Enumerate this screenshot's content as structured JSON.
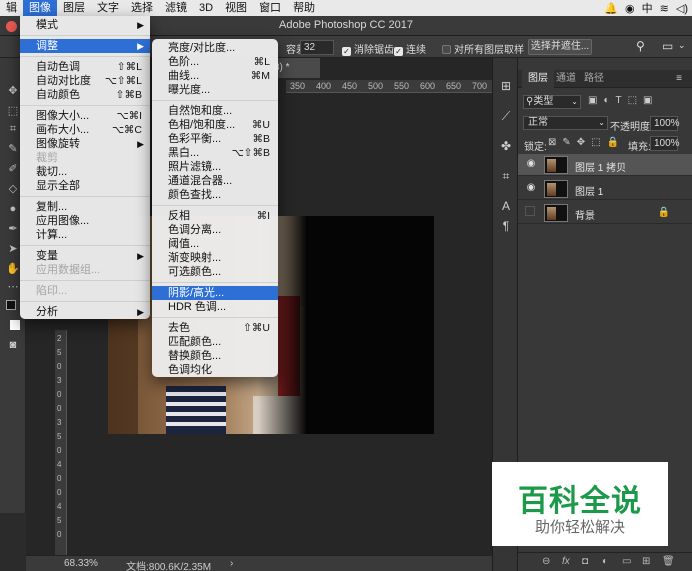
{
  "menubar": {
    "items": [
      "辑",
      "图像",
      "图层",
      "文字",
      "选择",
      "滤镜",
      "3D",
      "视图",
      "窗口",
      "帮助"
    ],
    "active_index": 1
  },
  "window": {
    "title": "Adobe Photoshop CC 2017"
  },
  "options_bar": {
    "tolerance_label": "容差:",
    "tolerance_value": "32",
    "antialias_label": "消除锯齿",
    "contiguous_label": "连续",
    "sample_all_label": "对所有图层取样",
    "select_mask_button": "选择并遮住..."
  },
  "document": {
    "tab_fragment": "8) *",
    "ruler_ticks": [
      "350",
      "400",
      "450",
      "500",
      "550",
      "600",
      "650",
      "700"
    ],
    "vruler_ticks": [
      "2",
      "5",
      "0",
      "3",
      "0",
      "0",
      "3",
      "5",
      "0",
      "4",
      "0",
      "0",
      "4",
      "5",
      "0"
    ]
  },
  "status": {
    "zoom": "68.33%",
    "doc": "文档:800.6K/2.35M",
    "arrow": "›"
  },
  "image_menu": [
    {
      "type": "item",
      "label": "模式",
      "submenu": true
    },
    {
      "type": "sep"
    },
    {
      "type": "item",
      "label": "调整",
      "submenu": true,
      "highlight": true
    },
    {
      "type": "sep"
    },
    {
      "type": "item",
      "label": "自动色调",
      "shortcut": "⇧⌘L"
    },
    {
      "type": "item",
      "label": "自动对比度",
      "shortcut": "⌥⇧⌘L"
    },
    {
      "type": "item",
      "label": "自动颜色",
      "shortcut": "⇧⌘B"
    },
    {
      "type": "sep"
    },
    {
      "type": "item",
      "label": "图像大小...",
      "shortcut": "⌥⌘I"
    },
    {
      "type": "item",
      "label": "画布大小...",
      "shortcut": "⌥⌘C"
    },
    {
      "type": "item",
      "label": "图像旋转",
      "submenu": true
    },
    {
      "type": "item",
      "label": "裁剪",
      "disabled": true
    },
    {
      "type": "item",
      "label": "裁切..."
    },
    {
      "type": "item",
      "label": "显示全部"
    },
    {
      "type": "sep"
    },
    {
      "type": "item",
      "label": "复制..."
    },
    {
      "type": "item",
      "label": "应用图像..."
    },
    {
      "type": "item",
      "label": "计算..."
    },
    {
      "type": "sep"
    },
    {
      "type": "item",
      "label": "变量",
      "submenu": true
    },
    {
      "type": "item",
      "label": "应用数据组...",
      "disabled": true
    },
    {
      "type": "sep"
    },
    {
      "type": "item",
      "label": "陷印...",
      "disabled": true
    },
    {
      "type": "sep"
    },
    {
      "type": "item",
      "label": "分析",
      "submenu": true
    }
  ],
  "adjust_menu": [
    {
      "type": "item",
      "label": "亮度/对比度..."
    },
    {
      "type": "item",
      "label": "色阶...",
      "shortcut": "⌘L"
    },
    {
      "type": "item",
      "label": "曲线...",
      "shortcut": "⌘M"
    },
    {
      "type": "item",
      "label": "曝光度..."
    },
    {
      "type": "sep"
    },
    {
      "type": "item",
      "label": "自然饱和度..."
    },
    {
      "type": "item",
      "label": "色相/饱和度...",
      "shortcut": "⌘U"
    },
    {
      "type": "item",
      "label": "色彩平衡...",
      "shortcut": "⌘B"
    },
    {
      "type": "item",
      "label": "黑白...",
      "shortcut": "⌥⇧⌘B"
    },
    {
      "type": "item",
      "label": "照片滤镜..."
    },
    {
      "type": "item",
      "label": "通道混合器..."
    },
    {
      "type": "item",
      "label": "颜色查找..."
    },
    {
      "type": "sep"
    },
    {
      "type": "item",
      "label": "反相",
      "shortcut": "⌘I"
    },
    {
      "type": "item",
      "label": "色调分离..."
    },
    {
      "type": "item",
      "label": "阈值..."
    },
    {
      "type": "item",
      "label": "渐变映射..."
    },
    {
      "type": "item",
      "label": "可选颜色..."
    },
    {
      "type": "sep"
    },
    {
      "type": "item",
      "label": "阴影/高光...",
      "highlight": true
    },
    {
      "type": "item",
      "label": "HDR 色调..."
    },
    {
      "type": "sep"
    },
    {
      "type": "item",
      "label": "去色",
      "shortcut": "⇧⌘U"
    },
    {
      "type": "item",
      "label": "匹配颜色..."
    },
    {
      "type": "item",
      "label": "替换颜色..."
    },
    {
      "type": "item",
      "label": "色调均化"
    }
  ],
  "layers_panel": {
    "tabs": [
      "图层",
      "通道",
      "路径"
    ],
    "filter_label": "类型",
    "blend_mode": "正常",
    "opacity_label": "不透明度:",
    "opacity_value": "100%",
    "lock_label": "锁定:",
    "fill_label": "填充:",
    "fill_value": "100%",
    "layers": [
      {
        "name": "图层 1 拷贝",
        "visible": true,
        "selected": true
      },
      {
        "name": "图层 1",
        "visible": true,
        "selected": false
      },
      {
        "name": "背景",
        "visible": false,
        "selected": false,
        "locked": true
      }
    ]
  },
  "watermark": {
    "title": "百科全说",
    "subtitle": "助你轻松解决"
  },
  "colors": {
    "menu_highlight": "#2d6fd5",
    "watermark_green": "#1d9a49"
  }
}
